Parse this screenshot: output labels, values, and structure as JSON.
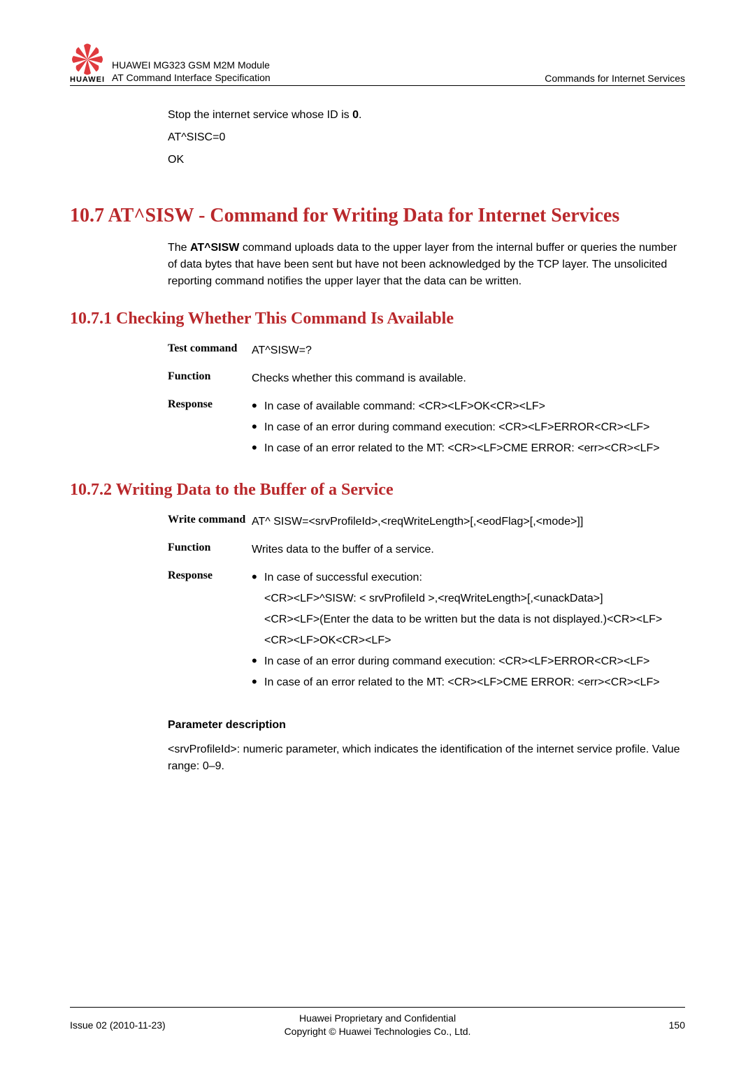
{
  "header": {
    "logo_text": "HUAWEI",
    "title1": "HUAWEI MG323 GSM M2M Module",
    "title2": "AT Command Interface Specification",
    "right": "Commands for Internet Services"
  },
  "intro": {
    "line1": "Stop the internet service whose ID is ",
    "line1_bold": "0",
    "line1_end": ".",
    "line2": "AT^SISC=0",
    "line3": "OK"
  },
  "section": {
    "title": "10.7 AT^SISW - Command for Writing Data for Internet Services",
    "intro_pre": "The ",
    "intro_bold": "AT^SISW",
    "intro_post": " command uploads data to the upper layer from the internal buffer or queries the number of data bytes that have been sent but have not been acknowledged by the TCP layer. The unsolicited reporting command notifies the upper layer that the data can be written."
  },
  "sub1": {
    "title": "10.7.1 Checking Whether This Command Is Available",
    "rows": {
      "test_label": "Test command",
      "test_val": "AT^SISW=?",
      "func_label": "Function",
      "func_val": "Checks whether this command is available.",
      "resp_label": "Response",
      "resp_b1": "In case of available command: <CR><LF>OK<CR><LF>",
      "resp_b2a": "In case of an error during command execution: <CR><LF>ERROR<CR><LF>",
      "resp_b3a": "In case of an error related to the MT: <CR><LF>CME ERROR: <err><CR><LF>"
    }
  },
  "sub2": {
    "title": "10.7.2 Writing Data to the Buffer of a Service",
    "rows": {
      "write_label": "Write command",
      "write_val": "AT^ SISW=<srvProfileId>,<reqWriteLength>[,<eodFlag>[,<mode>]]",
      "func_label": "Function",
      "func_val": "Writes data to the buffer of a service.",
      "resp_label": "Response",
      "resp_b1": "In case of successful execution:",
      "resp_b1_s1": "<CR><LF>^SISW: < srvProfileId >,<reqWriteLength>[,<unackData>]",
      "resp_b1_s2": "<CR><LF>(Enter the data to be written but the data is not displayed.)<CR><LF>",
      "resp_b1_s3": "<CR><LF>OK<CR><LF>",
      "resp_b2": "In case of an error during command execution: <CR><LF>ERROR<CR><LF>",
      "resp_b3": "In case of an error related to the MT: <CR><LF>CME ERROR: <err><CR><LF>"
    }
  },
  "param": {
    "heading": "Parameter description",
    "text": "<srvProfileId>: numeric parameter, which indicates the identification of the internet service profile. Value range: 0–9."
  },
  "footer": {
    "left": "Issue 02 (2010-11-23)",
    "center1": "Huawei Proprietary and Confidential",
    "center2": "Copyright © Huawei Technologies Co., Ltd.",
    "right": "150"
  }
}
